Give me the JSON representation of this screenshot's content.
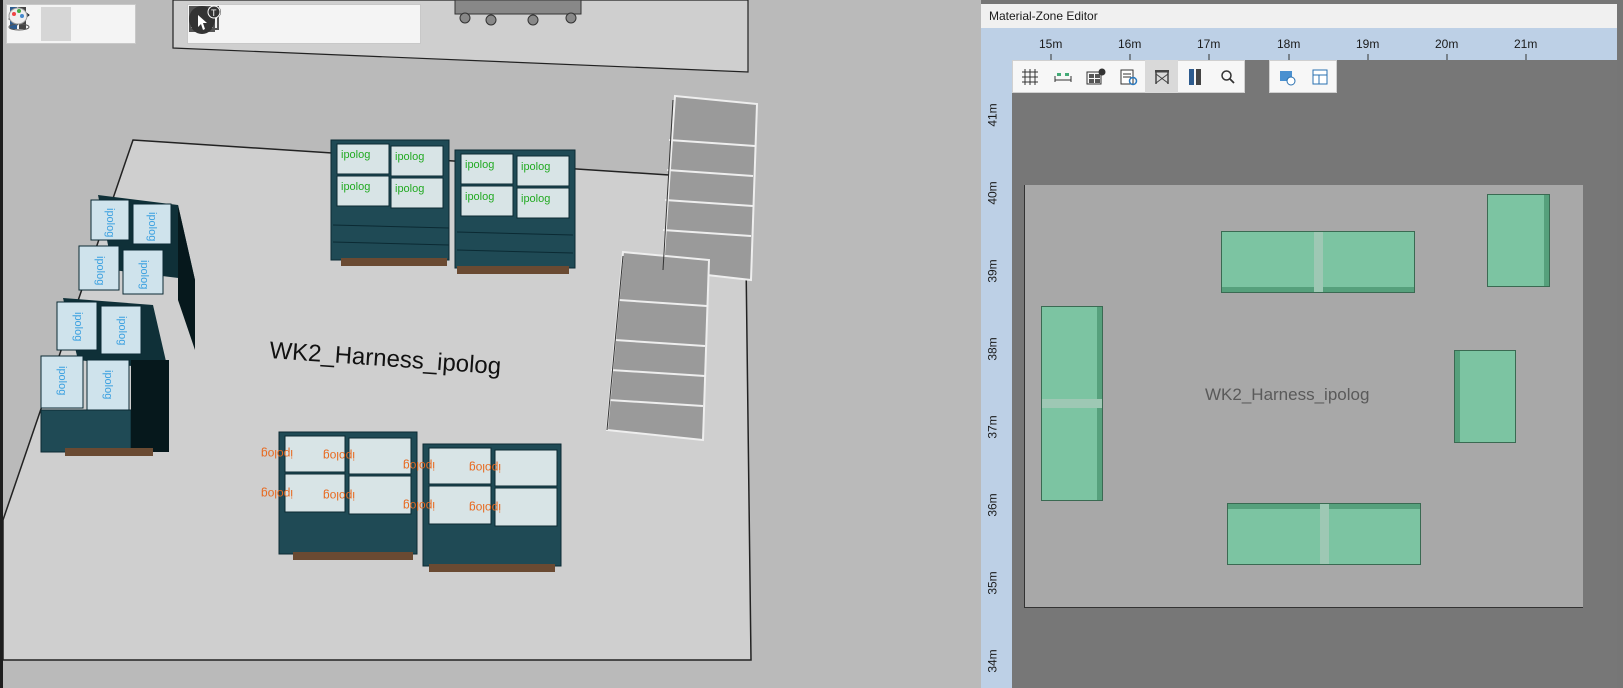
{
  "viewport3d": {
    "zone_label": "WK2_Harness_ipolog",
    "box_label_top": "ipolog",
    "box_label_bottom": "ipolog",
    "toolbar_left": [
      "layout-view-icon",
      "rack-view-icon",
      "person-on-floor-icon",
      "palette-icon"
    ],
    "toolbar_right": [
      "shelf-icon",
      "person-icon",
      "rack-grid-icon",
      "rack-info-icon",
      "cursor-icon",
      "cursor-info-icon"
    ]
  },
  "editor": {
    "title": "Material-Zone Editor",
    "ruler_x": [
      "15m",
      "16m",
      "17m",
      "18m",
      "19m",
      "20m",
      "21m"
    ],
    "ruler_y": [
      "41m",
      "40m",
      "39m",
      "38m",
      "37m",
      "36m",
      "35m",
      "34m"
    ],
    "toolbar": [
      "grid-icon",
      "measure-icon",
      "rack-info-icon",
      "properties-icon",
      "shelf-icon",
      "rack-view-icon",
      "search-icon"
    ],
    "toolbar2": [
      "zone-settings-icon",
      "layout-table-icon"
    ],
    "zone_label": "WK2_Harness_ipolog"
  },
  "colors": {
    "viewport_bg": "#bababa",
    "floor": "#cfcfcf",
    "rack_2d": "#7cc4a2",
    "ruler": "#bdd0e6",
    "box_text_green": "#22aa22",
    "box_text_blue": "#3aa0e0",
    "box_text_orange": "#e86a20"
  }
}
